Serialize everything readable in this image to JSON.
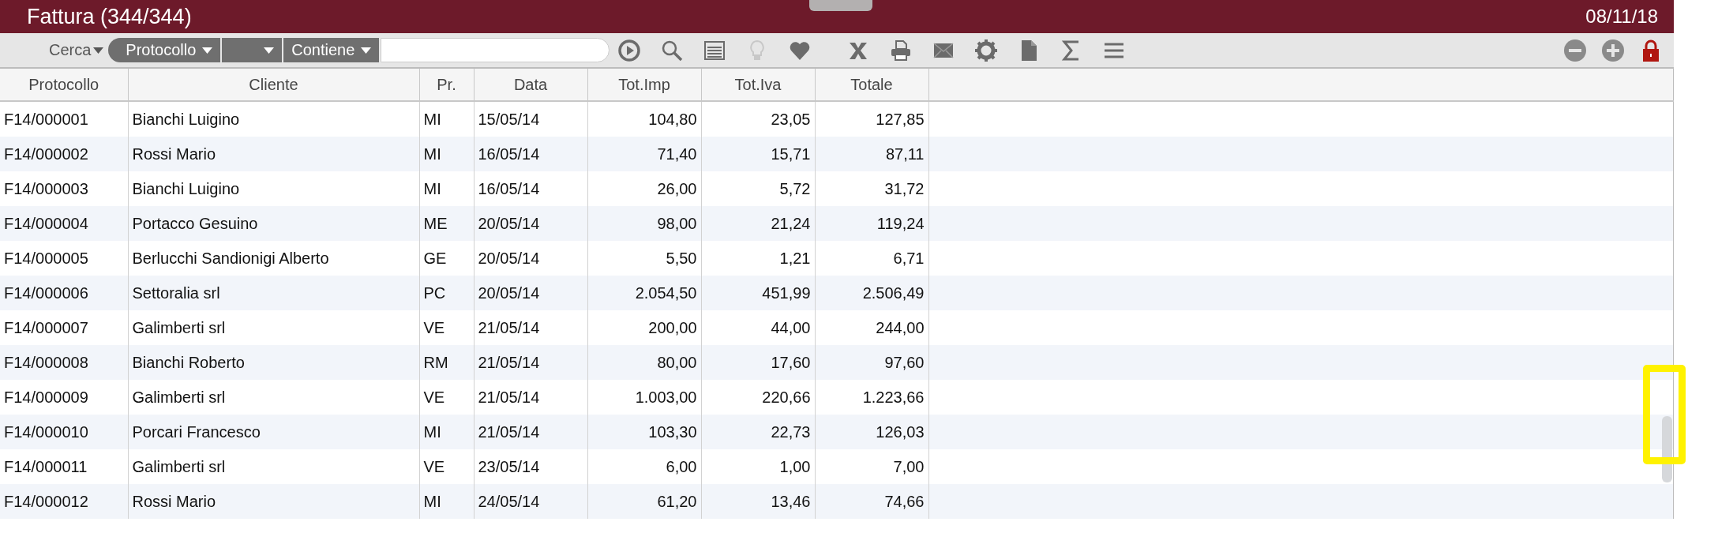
{
  "window": {
    "title": "Fattura (344/344)",
    "date": "08/11/18"
  },
  "toolbar": {
    "search_label": "Cerca",
    "field_dropdown": "Protocollo",
    "operator_dropdown": "Contiene"
  },
  "table": {
    "columns": [
      "Protocollo",
      "Cliente",
      "Pr.",
      "Data",
      "Tot.Imp",
      "Tot.Iva",
      "Totale"
    ],
    "rows": [
      [
        "F14/000001",
        "Bianchi Luigino",
        "MI",
        "15/05/14",
        "104,80",
        "23,05",
        "127,85"
      ],
      [
        "F14/000002",
        "Rossi Mario",
        "MI",
        "16/05/14",
        "71,40",
        "15,71",
        "87,11"
      ],
      [
        "F14/000003",
        "Bianchi Luigino",
        "MI",
        "16/05/14",
        "26,00",
        "5,72",
        "31,72"
      ],
      [
        "F14/000004",
        "Portacco Gesuino",
        "ME",
        "20/05/14",
        "98,00",
        "21,24",
        "119,24"
      ],
      [
        "F14/000005",
        "Berlucchi Sandionigi Alberto",
        "GE",
        "20/05/14",
        "5,50",
        "1,21",
        "6,71"
      ],
      [
        "F14/000006",
        "Settoralia srl",
        "PC",
        "20/05/14",
        "2.054,50",
        "451,99",
        "2.506,49"
      ],
      [
        "F14/000007",
        "Galimberti srl",
        "VE",
        "21/05/14",
        "200,00",
        "44,00",
        "244,00"
      ],
      [
        "F14/000008",
        "Bianchi Roberto",
        "RM",
        "21/05/14",
        "80,00",
        "17,60",
        "97,60"
      ],
      [
        "F14/000009",
        "Galimberti srl",
        "VE",
        "21/05/14",
        "1.003,00",
        "220,66",
        "1.223,66"
      ],
      [
        "F14/000010",
        "Porcari Francesco",
        "MI",
        "21/05/14",
        "103,30",
        "22,73",
        "126,03"
      ],
      [
        "F14/000011",
        "Galimberti srl",
        "VE",
        "23/05/14",
        "6,00",
        "1,00",
        "7,00"
      ],
      [
        "F14/000012",
        "Rossi Mario",
        "MI",
        "24/05/14",
        "61,20",
        "13,46",
        "74,66"
      ]
    ]
  }
}
